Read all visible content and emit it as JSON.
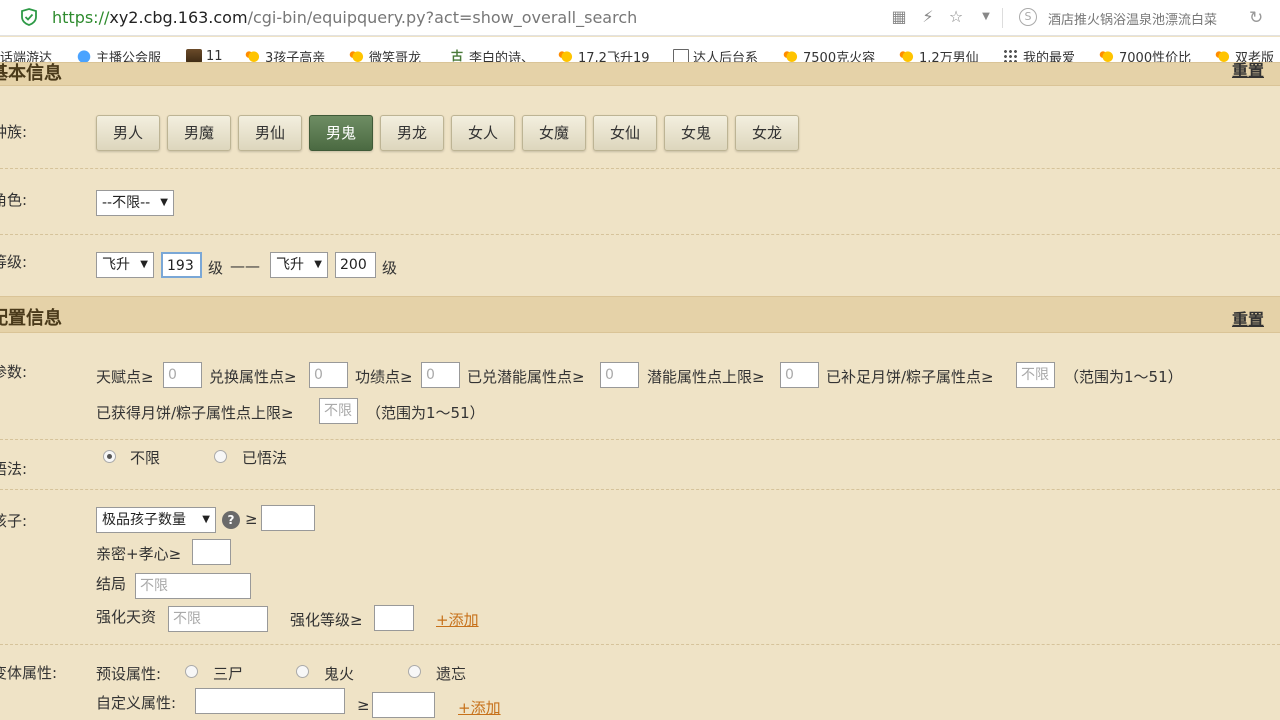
{
  "browser": {
    "url_scheme": "https://",
    "url_host": "xy2.cbg.163.com",
    "url_rest": "/cgi-bin/equipquery.py?act=show_overall_search",
    "hot_search": "酒店推火锅浴温泉池漂流白菜",
    "bookmarks": [
      {
        "label": "话端游达",
        "icon": "cloud-icon"
      },
      {
        "label": "主播公会服",
        "icon": "cloud-icon"
      },
      {
        "label": "11",
        "icon": "game-icon"
      },
      {
        "label": "3孩子高亲",
        "icon": "duck-icon"
      },
      {
        "label": "微笑哥龙",
        "icon": "duck-icon"
      },
      {
        "label": "李白的诗、",
        "icon": "poem-icon"
      },
      {
        "label": "17,2飞升19",
        "icon": "duck-icon"
      },
      {
        "label": "达人后台系",
        "icon": "doc-icon"
      },
      {
        "label": "7500克火容",
        "icon": "duck-icon"
      },
      {
        "label": "1.2万男仙",
        "icon": "duck-icon"
      },
      {
        "label": "我的最爱",
        "icon": "grid-icon"
      },
      {
        "label": "7000性价比",
        "icon": "duck-icon"
      },
      {
        "label": "双老版",
        "icon": "duck-icon"
      }
    ]
  },
  "basic": {
    "title": "基本信息",
    "reset": "重置",
    "race_label": "种族:",
    "races": [
      "男人",
      "男魔",
      "男仙",
      "男鬼",
      "男龙",
      "女人",
      "女魔",
      "女仙",
      "女鬼",
      "女龙"
    ],
    "race_selected": "男鬼",
    "role_label": "角色:",
    "role_value": "--不限--",
    "level_label": "等级:",
    "level_from_type": "飞升",
    "level_from": "193",
    "level_unit": "级",
    "level_dash": "——",
    "level_to_type": "飞升",
    "level_to": "200"
  },
  "config": {
    "title": "配置信息",
    "reset": "重置",
    "params_label": "参数:",
    "talent_label": "天赋点≥",
    "talent_value": "0",
    "exchange_label": "兑换属性点≥",
    "exchange_value": "0",
    "merit_label": "功绩点≥",
    "merit_value": "0",
    "potential_label": "已兑潜能属性点≥",
    "potential_value": "0",
    "potential_max_label": "潜能属性点上限≥",
    "potential_max_value": "0",
    "mooncake_label": "已补足月饼/粽子属性点≥",
    "mooncake_placeholder": "不限",
    "range_note": "（范围为1～51）",
    "mooncake_max_label": "已获得月饼/粽子属性点上限≥",
    "mooncake_max_placeholder": "不限",
    "range_note2": "（范围为1～51）",
    "enlight_label": "悟法:",
    "enlight_options": [
      "不限",
      "已悟法"
    ],
    "enlight_selected": "不限",
    "child_label": "孩子:",
    "child_select": "极品孩子数量",
    "ge": "≥",
    "intimacy_label": "亲密+孝心≥",
    "ending_label": "结局",
    "ending_placeholder": "不限",
    "strength_label": "强化天资",
    "strength_placeholder": "不限",
    "strength_level_label": "强化等级≥",
    "add_link": "+添加",
    "body_label": "变体属性:",
    "preset_label": "预设属性:",
    "preset_options": [
      "三尸",
      "鬼火",
      "遗忘"
    ],
    "custom_label": "自定义属性:",
    "custom_ge": "≥",
    "add_link2": "+添加"
  }
}
